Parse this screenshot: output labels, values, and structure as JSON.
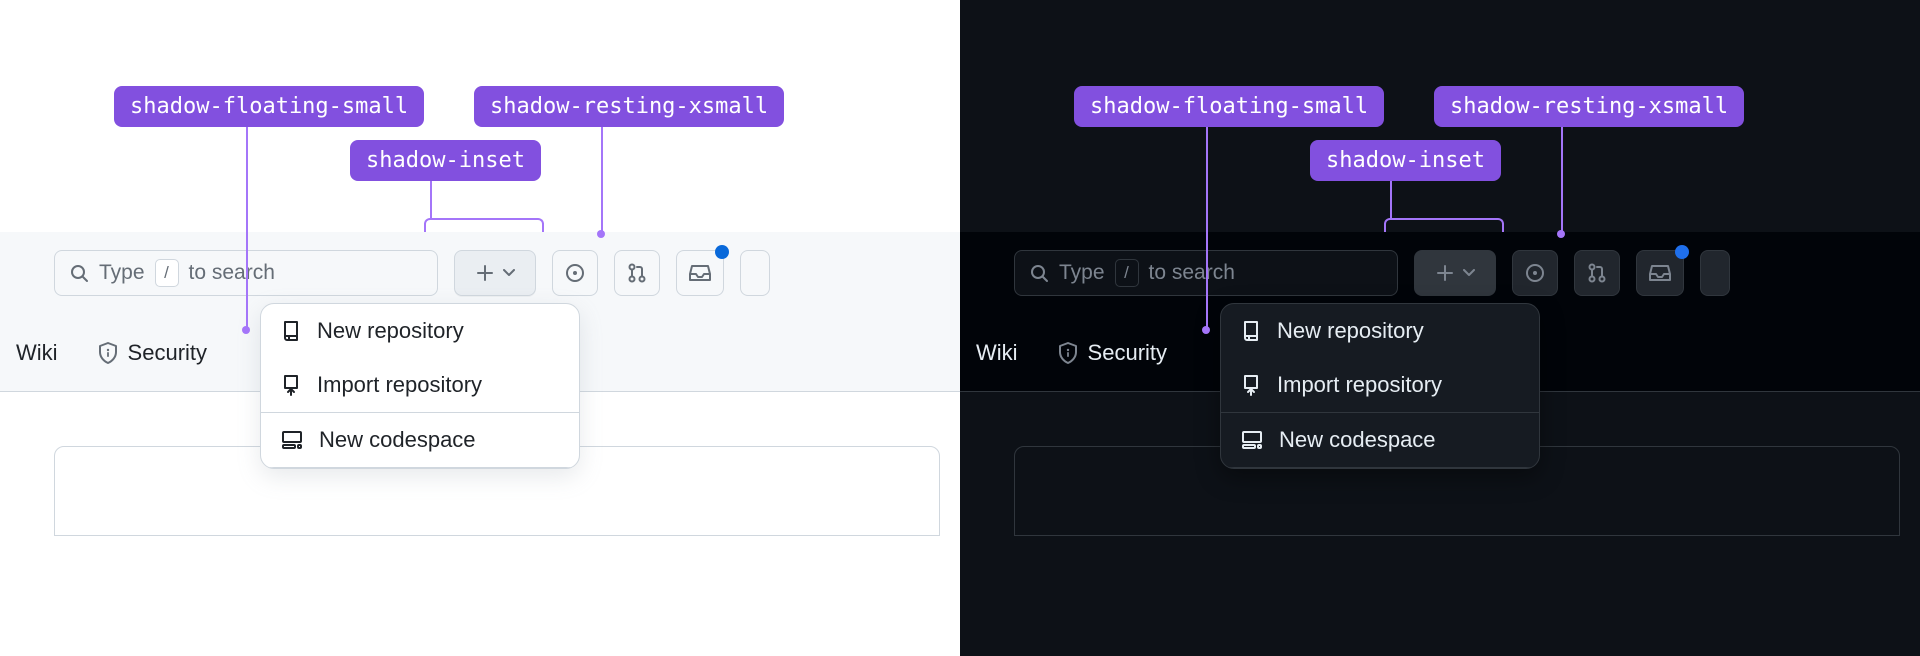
{
  "annotations": {
    "floating_small": "shadow-floating-small",
    "inset": "shadow-inset",
    "resting_xsmall": "shadow-resting-xsmall"
  },
  "search": {
    "prefix": "Type",
    "key": "/",
    "suffix": "to search"
  },
  "tabs": {
    "wiki": "Wiki",
    "security": "Security"
  },
  "menu": {
    "new_repo": "New repository",
    "import_repo": "Import repository",
    "new_codespace": "New codespace"
  },
  "colors": {
    "annotation_bg": "#8250df",
    "annotation_line": "#a475f9",
    "notification_dot_light": "#0969da",
    "notification_dot_dark": "#1f6feb"
  }
}
